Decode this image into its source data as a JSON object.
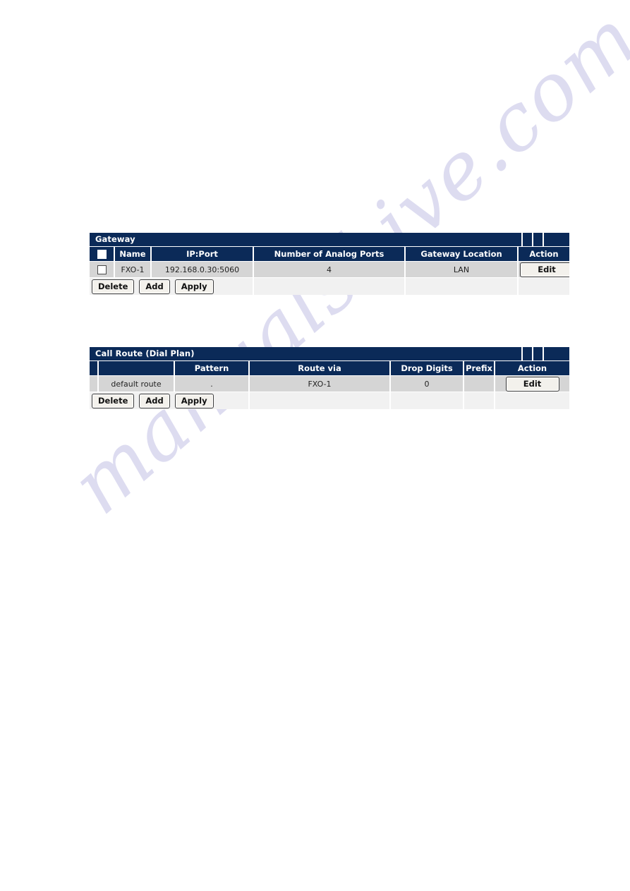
{
  "watermark": {
    "text": "manualshive.com"
  },
  "gateway": {
    "title": "Gateway",
    "columns": {
      "select": "",
      "name": "Name",
      "ipport": "IP:Port",
      "ports": "Number of Analog Ports",
      "location": "Gateway Location",
      "action": "Action"
    },
    "rows": [
      {
        "selected": false,
        "name": "FXO-1",
        "ipport": "192.168.0.30:5060",
        "ports": "4",
        "location": "LAN",
        "action": "Edit"
      }
    ],
    "buttons": {
      "delete": "Delete",
      "add": "Add",
      "apply": "Apply"
    }
  },
  "call_route": {
    "title": "Call Route (Dial Plan)",
    "columns": {
      "select": "",
      "label": "",
      "pattern": "Pattern",
      "route_via": "Route via",
      "drop_digits": "Drop Digits",
      "prefix": "Prefix",
      "action": "Action"
    },
    "rows": [
      {
        "label": "default route",
        "pattern": ".",
        "route_via": "FXO-1",
        "drop_digits": "0",
        "prefix": "",
        "action": "Edit"
      }
    ],
    "buttons": {
      "delete": "Delete",
      "add": "Add",
      "apply": "Apply"
    }
  },
  "colors": {
    "header_blue": "#0b2a58",
    "row_gray": "#d5d5d5",
    "footer_gray": "#f1f1f1",
    "watermark": "#c9c7e8"
  }
}
